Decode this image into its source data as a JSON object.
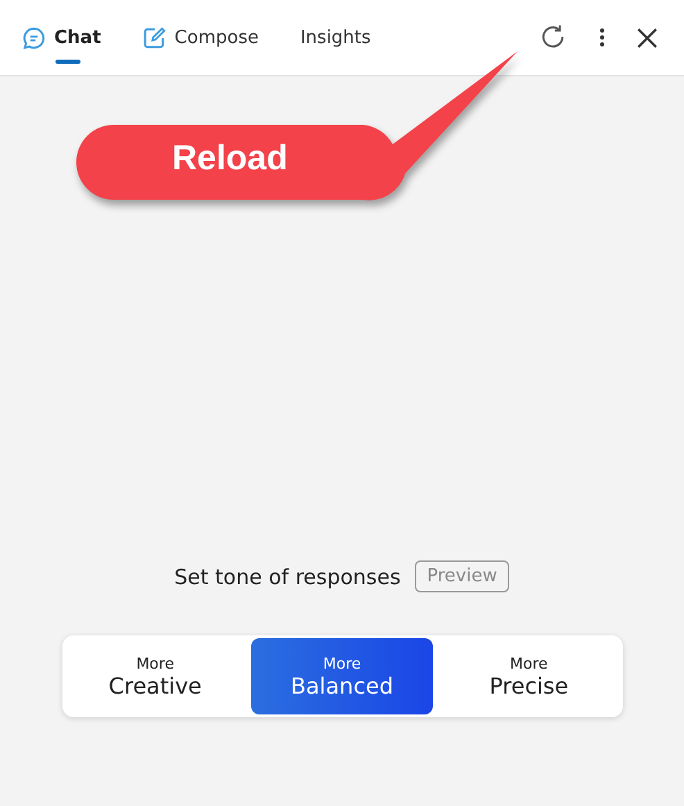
{
  "tabs": [
    {
      "label": "Chat",
      "kind": "chat",
      "selected": true
    },
    {
      "label": "Compose",
      "kind": "compose",
      "selected": false
    },
    {
      "label": "Insights",
      "kind": "plain",
      "selected": false
    }
  ],
  "callout": {
    "text": "Reload"
  },
  "tone": {
    "label": "Set tone of responses",
    "preview": "Preview",
    "options": [
      {
        "small": "More",
        "label": "Creative",
        "selected": false
      },
      {
        "small": "More",
        "label": "Balanced",
        "selected": true
      },
      {
        "small": "More",
        "label": "Precise",
        "selected": false
      }
    ]
  }
}
